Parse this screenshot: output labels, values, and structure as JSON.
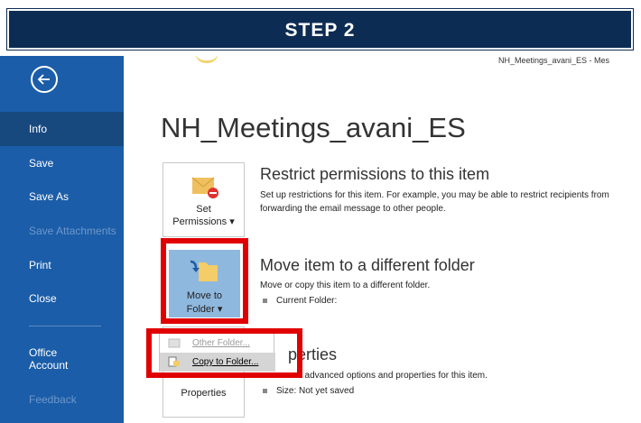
{
  "banner": {
    "text": "STEP 2"
  },
  "window": {
    "filename": "NH_Meetings_avani_ES - Mes"
  },
  "sidebar": {
    "items": [
      {
        "label": "Info",
        "active": true
      },
      {
        "label": "Save"
      },
      {
        "label": "Save As"
      },
      {
        "label": "Save Attachments",
        "disabled": true
      },
      {
        "label": "Print"
      },
      {
        "label": "Close"
      },
      {
        "label": "Office Account"
      },
      {
        "label": "Feedback",
        "disabled": true
      }
    ]
  },
  "main": {
    "title": "NH_Meetings_avani_ES",
    "sections": [
      {
        "button_label": "Set\nPermissions ▾",
        "title": "Restrict permissions to this item",
        "description": "Set up restrictions for this item. For example, you may be able to restrict recipients from forwarding the email message to other people."
      },
      {
        "button_label": "Move to\nFolder ▾",
        "title": "Move item to a different folder",
        "description": "Move or copy this item to a different folder.",
        "bullet": "Current Folder:"
      },
      {
        "button_label": "Properties",
        "title_partial": "perties",
        "description_partial": "ew advanced options and properties for this item.",
        "bullet": "Size:   Not yet saved"
      }
    ]
  },
  "dropdown": {
    "items": [
      {
        "label": "Other Folder...",
        "disabled": true
      },
      {
        "label": "Copy to Folder...",
        "hover": true
      }
    ]
  },
  "colors": {
    "sidebar": "#1b5da8",
    "active": "#17497f",
    "banner": "#0d2c53",
    "highlight": "#e00000",
    "accent_blue_button": "#8fb8de"
  }
}
